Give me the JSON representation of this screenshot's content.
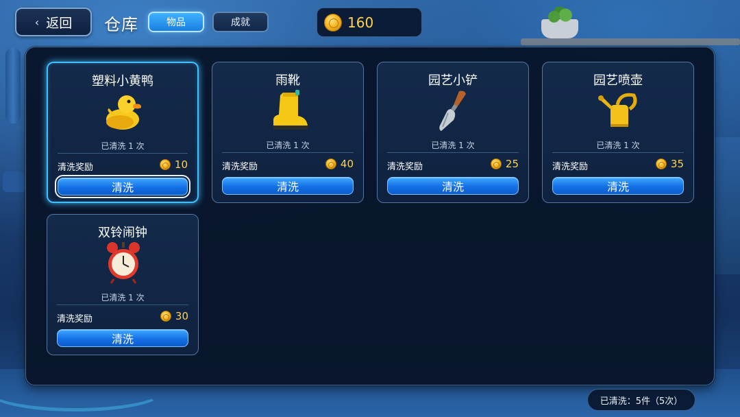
{
  "header": {
    "back_label": "返回",
    "title": "仓库",
    "tabs": [
      {
        "label": "物品",
        "active": true
      },
      {
        "label": "成就",
        "active": false
      }
    ],
    "coins": "160"
  },
  "items": [
    {
      "name": "塑料小黄鸭",
      "icon": "rubber-duck-icon",
      "count": "已清洗 1 次",
      "reward_label": "清洗奖励",
      "reward": "10",
      "button": "清洗",
      "selected": true
    },
    {
      "name": "雨靴",
      "icon": "rain-boot-icon",
      "count": "已清洗 1 次",
      "reward_label": "清洗奖励",
      "reward": "40",
      "button": "清洗",
      "selected": false
    },
    {
      "name": "园艺小铲",
      "icon": "garden-trowel-icon",
      "count": "已清洗 1 次",
      "reward_label": "清洗奖励",
      "reward": "25",
      "button": "清洗",
      "selected": false
    },
    {
      "name": "园艺喷壶",
      "icon": "watering-can-icon",
      "count": "已清洗 1 次",
      "reward_label": "清洗奖励",
      "reward": "35",
      "button": "清洗",
      "selected": false
    },
    {
      "name": "双铃闹钟",
      "icon": "alarm-clock-icon",
      "count": "已清洗 1 次",
      "reward_label": "清洗奖励",
      "reward": "30",
      "button": "清洗",
      "selected": false
    }
  ],
  "footer": {
    "status": "已清洗：5件（5次）"
  },
  "colors": {
    "accent": "#1a7fe0",
    "coin": "#ffd44d",
    "panel": "#08152a"
  }
}
